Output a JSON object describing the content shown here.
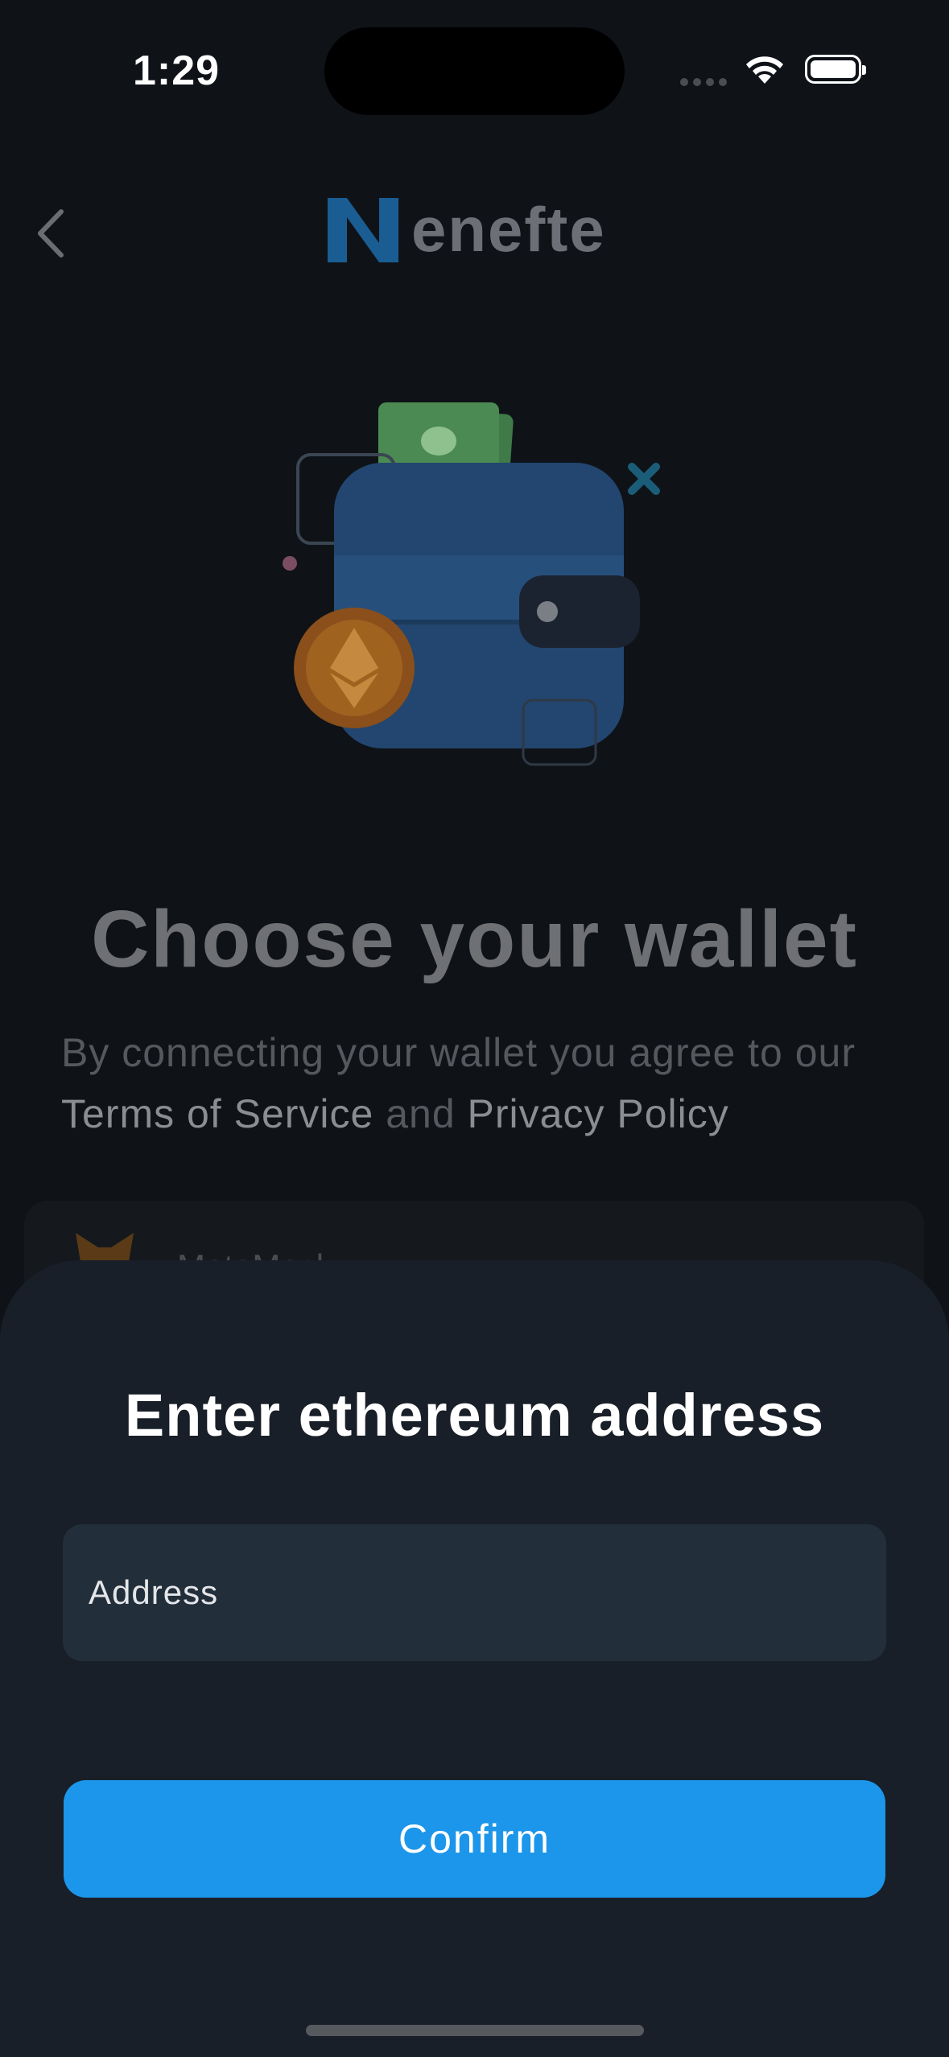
{
  "status_bar": {
    "time": "1:29"
  },
  "header": {
    "logo_text": "enefte"
  },
  "screen": {
    "headline": "Choose your wallet",
    "subtitle": {
      "prefix": "By connecting your wallet you agree to our ",
      "terms_link": "Terms of Service",
      "and": " and ",
      "privacy_link": "Privacy Policy"
    },
    "wallet_option_label": "MetaMask"
  },
  "sheet": {
    "title": "Enter ethereum address",
    "address_placeholder": "Address",
    "address_value": "",
    "confirm_label": "Confirm"
  },
  "colors": {
    "accent": "#1c96ea",
    "sheet_bg": "#181f28",
    "input_bg": "#232e3b",
    "logo_blue": "#1a5d93"
  },
  "icons": [
    "back-chevron-icon",
    "wifi-icon",
    "battery-icon",
    "enefte-logo-icon",
    "metamask-fox-icon",
    "wallet-illustration"
  ]
}
